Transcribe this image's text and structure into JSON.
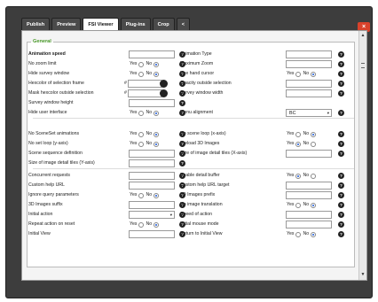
{
  "tabs": [
    {
      "label": "Publish",
      "active": false
    },
    {
      "label": "Preview",
      "active": false
    },
    {
      "label": "FSI Viewer",
      "active": true
    },
    {
      "label": "Plug-ins",
      "active": false
    },
    {
      "label": "Crop",
      "active": false
    },
    {
      "label": "<",
      "active": false
    }
  ],
  "close_label": "×",
  "section_title": "General",
  "radio": {
    "yes": "Yes",
    "no": "No"
  },
  "hash": "#",
  "help_glyph": "?",
  "left_rows": [
    {
      "label": "Animation speed",
      "type": "text",
      "bold": true
    },
    {
      "label": "No zoom limit",
      "type": "yesno",
      "selected": "no"
    },
    {
      "label": "Hide survey window",
      "type": "yesno",
      "selected": "no"
    },
    {
      "label": "Hexcolor of selection frame",
      "type": "color"
    },
    {
      "label": "Mask hexcolor outside selection",
      "type": "color"
    },
    {
      "label": "Survey window height",
      "type": "text"
    },
    {
      "label": "Hide user interface",
      "type": "yesno",
      "selected": "no"
    },
    {
      "label": "",
      "type": "gap"
    },
    {
      "label": "No SceneSet animations",
      "type": "yesno",
      "selected": "no"
    },
    {
      "label": "No set loop (y-axis)",
      "type": "yesno",
      "selected": "no"
    },
    {
      "label": "Scene sequence definition",
      "type": "text"
    },
    {
      "label": "Size of image detail tiles (Y-axis)",
      "type": "text"
    },
    {
      "label": "Concurrent requests",
      "type": "text"
    },
    {
      "label": "Custom help URL",
      "type": "text"
    },
    {
      "label": "Ignore query parameters",
      "type": "yesno",
      "selected": "no"
    },
    {
      "label": "3D Images suffix",
      "type": "text"
    },
    {
      "label": "Initial action",
      "type": "select",
      "value": ""
    },
    {
      "label": "Repeat action on reset",
      "type": "yesno",
      "selected": "no"
    },
    {
      "label": "Initial View",
      "type": "text"
    }
  ],
  "right_rows": [
    {
      "label": "Animation Type",
      "type": "text"
    },
    {
      "label": "Maximum Zoom",
      "type": "text"
    },
    {
      "label": "Use hand cursor",
      "type": "yesno",
      "selected": "no"
    },
    {
      "label": "Opacity outside selection",
      "type": "text"
    },
    {
      "label": "Survey window width",
      "type": "text"
    },
    {
      "label": "",
      "type": "empty"
    },
    {
      "label": "Menu alignment",
      "type": "select",
      "value": "BC"
    },
    {
      "label": "",
      "type": "gap"
    },
    {
      "label": "No scene loop (x-axis)",
      "type": "yesno",
      "selected": "no"
    },
    {
      "label": "Preload 3D Images",
      "type": "yesno",
      "selected": "yes"
    },
    {
      "label": "Size of image detail tiles (X-axis)",
      "type": "text"
    },
    {
      "label": "",
      "type": "empty"
    },
    {
      "label": "Enable detail buffer",
      "type": "yesno",
      "selected": "yes"
    },
    {
      "label": "Custom help URL target",
      "type": "text"
    },
    {
      "label": "3D Images prefix",
      "type": "text"
    },
    {
      "label": "No image translation",
      "type": "yesno",
      "selected": "no"
    },
    {
      "label": "Speed of action",
      "type": "text"
    },
    {
      "label": "Initial mouse mode",
      "type": "text"
    },
    {
      "label": "Return to Initial View",
      "type": "yesno",
      "selected": "no"
    }
  ],
  "colors": {
    "accent_green": "#4a9a2a",
    "close_red": "#d9422b",
    "radio_blue": "#1e5ad6",
    "frame_dark": "#3d3d3d"
  }
}
